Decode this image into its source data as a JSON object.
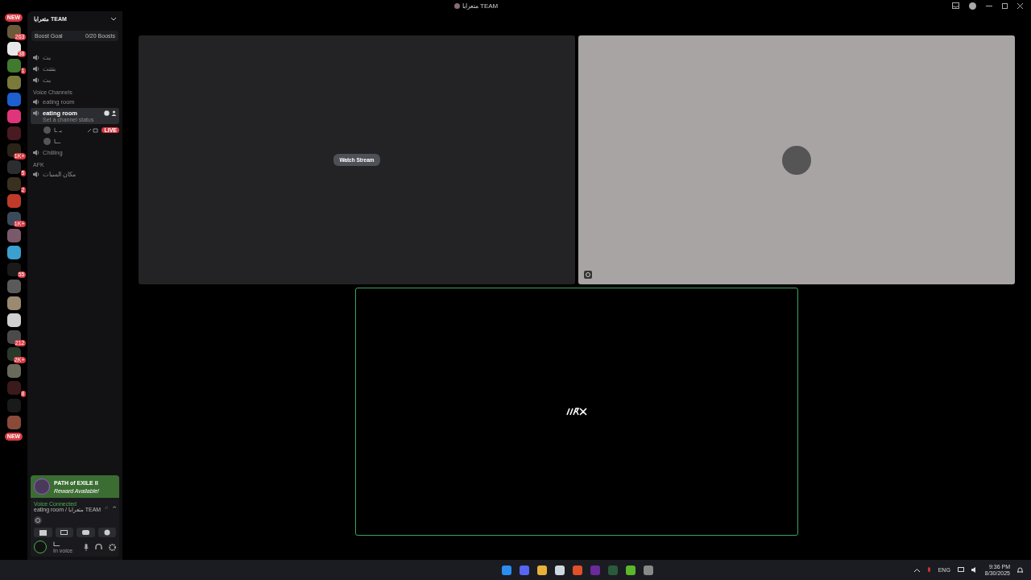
{
  "window": {
    "title": "متعرابا TEAM"
  },
  "servers": {
    "top_pill": "NEW",
    "bottom_pill": "NEW",
    "items": [
      {
        "badge": "263",
        "color": "#6b5a3a"
      },
      {
        "badge": "38",
        "color": "#e8e8e8"
      },
      {
        "badge": "1",
        "color": "#3f7a2e"
      },
      {
        "color": "#7a7a3a"
      },
      {
        "color": "#1e5fd0"
      },
      {
        "color": "#e0357a"
      },
      {
        "color": "#4a1a22"
      },
      {
        "badge": "1K+",
        "color": "#2a2418"
      },
      {
        "badge": "5",
        "color": "#2b2d31"
      },
      {
        "badge": "2",
        "color": "#3a3020"
      },
      {
        "color": "#c03a2a"
      },
      {
        "badge": "1K+",
        "color": "#3a4a5a"
      },
      {
        "color": "#7a5a6a"
      },
      {
        "color": "#3aa0d0"
      },
      {
        "badge": "55",
        "color": "#1a1a1a"
      },
      {
        "color": "#5a5a5a"
      },
      {
        "color": "#9a8a70"
      },
      {
        "color": "#cfcfcf"
      },
      {
        "badge": "212",
        "color": "#4a4a4a"
      },
      {
        "badge": "2K+",
        "color": "#2a3a2a"
      },
      {
        "color": "#6a6a5a"
      },
      {
        "badge": "8",
        "color": "#3a1a1a"
      },
      {
        "color": "#1a1a1a"
      },
      {
        "color": "#8a4a3a"
      }
    ]
  },
  "server": {
    "name": "متعرابا TEAM",
    "boost_goal": "Boost Goal",
    "boost_count": "0/20 Boosts"
  },
  "channels": [
    {
      "kind": "channel",
      "name": "بت",
      "selected": false
    },
    {
      "kind": "channel",
      "name": "بتتتت",
      "selected": false
    },
    {
      "kind": "channel",
      "name": "بت",
      "selected": false
    },
    {
      "kind": "category",
      "name": "Voice Channels"
    },
    {
      "kind": "channel",
      "name": "eating room",
      "selected": false
    },
    {
      "kind": "channel",
      "name": "eating room",
      "selected": true,
      "status": "Set a channel status"
    },
    {
      "kind": "user",
      "name": "بـ ـا",
      "live": "LIVE"
    },
    {
      "kind": "user",
      "name": "ـــا"
    },
    {
      "kind": "channel",
      "name": "Chilling",
      "selected": false
    },
    {
      "kind": "category",
      "name": "AFK"
    },
    {
      "kind": "channel",
      "name": "مكان السبات",
      "selected": false
    }
  ],
  "promo": {
    "title": "PATH of EXILE II",
    "subtitle": "Reward Available!"
  },
  "voice": {
    "status": "Voice Connected",
    "location": "eating room / متعرابا TEAM"
  },
  "user": {
    "name": "ـــا",
    "status": "In voice"
  },
  "tiles": [
    {
      "kind": "stream",
      "button": "Watch Stream",
      "speaking": false
    },
    {
      "kind": "avatar",
      "speaking": false
    },
    {
      "kind": "logo",
      "speaking": true
    }
  ],
  "tray": {
    "language": "ENG",
    "time": "9:36 PM",
    "date": "8/30/2025"
  }
}
